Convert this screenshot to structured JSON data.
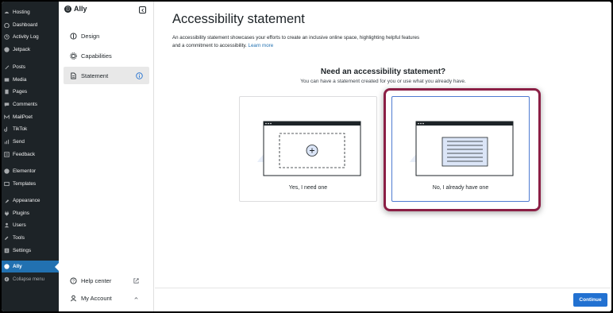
{
  "wp_menu": {
    "items": [
      {
        "label": "Hosting",
        "icon": "hosting-icon"
      },
      {
        "label": "Dashboard",
        "icon": "dashboard-icon"
      },
      {
        "label": "Activity Log",
        "icon": "activity-log-icon"
      },
      {
        "label": "Jetpack",
        "icon": "jetpack-icon"
      },
      {
        "label": "Posts",
        "icon": "posts-icon"
      },
      {
        "label": "Media",
        "icon": "media-icon"
      },
      {
        "label": "Pages",
        "icon": "pages-icon"
      },
      {
        "label": "Comments",
        "icon": "comments-icon"
      },
      {
        "label": "MailPoet",
        "icon": "mailpoet-icon"
      },
      {
        "label": "TikTok",
        "icon": "tiktok-icon"
      },
      {
        "label": "Send",
        "icon": "send-icon"
      },
      {
        "label": "Feedback",
        "icon": "feedback-icon"
      },
      {
        "label": "Elementor",
        "icon": "elementor-icon"
      },
      {
        "label": "Templates",
        "icon": "templates-icon"
      },
      {
        "label": "Appearance",
        "icon": "appearance-icon"
      },
      {
        "label": "Plugins",
        "icon": "plugins-icon"
      },
      {
        "label": "Users",
        "icon": "users-icon"
      },
      {
        "label": "Tools",
        "icon": "tools-icon"
      },
      {
        "label": "Settings",
        "icon": "settings-icon"
      },
      {
        "label": "Ally",
        "icon": "ally-icon",
        "active": true
      }
    ],
    "collapse_label": "Collapse menu"
  },
  "ally_panel": {
    "title": "Ally",
    "nav": [
      {
        "label": "Design",
        "icon": "design-icon"
      },
      {
        "label": "Capabilities",
        "icon": "capabilities-icon"
      },
      {
        "label": "Statement",
        "icon": "statement-icon",
        "active": true
      }
    ],
    "help_center": "Help center",
    "my_account": "My Account"
  },
  "main": {
    "title": "Accessibility statement",
    "description": "An accessibility statement showcases your efforts to create an inclusive online space, highlighting helpful features and a commitment to accessibility.",
    "learn_more": "Learn more",
    "question": "Need an accessibility statement?",
    "subquestion": "You can have a statement created for you or use what you already have.",
    "options": [
      {
        "label": "Yes, I need one",
        "selected": false
      },
      {
        "label": "No, I already have one",
        "selected": true
      }
    ],
    "continue_label": "Continue"
  },
  "colors": {
    "wp_sidebar_bg": "#1d2327",
    "wp_active": "#2271b1",
    "highlight_ring": "#8b1f45",
    "selected_border": "#4f7bd1",
    "continue_bg": "#2271d1"
  }
}
